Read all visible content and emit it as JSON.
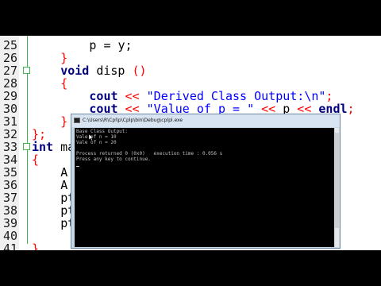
{
  "editor": {
    "lines": [
      {
        "n": "25",
        "indent": 8,
        "parts": [
          [
            "p = y;",
            "plain"
          ]
        ]
      },
      {
        "n": "26",
        "indent": 4,
        "parts": [
          [
            "}",
            "brc"
          ]
        ]
      },
      {
        "n": "27",
        "indent": 4,
        "parts": [
          [
            "void",
            "kw"
          ],
          [
            " disp ",
            "plain"
          ],
          [
            "()",
            "brc"
          ]
        ],
        "fold": true
      },
      {
        "n": "28",
        "indent": 4,
        "parts": [
          [
            "{",
            "brc"
          ]
        ]
      },
      {
        "n": "29",
        "indent": 8,
        "parts": [
          [
            "cout",
            "kw"
          ],
          [
            " ",
            "plain"
          ],
          [
            "<<",
            "op"
          ],
          [
            " ",
            "plain"
          ],
          [
            "\"Derived Class Output:\\n\"",
            "str"
          ],
          [
            ";",
            "op"
          ]
        ]
      },
      {
        "n": "30",
        "indent": 8,
        "parts": [
          [
            "cout",
            "kw"
          ],
          [
            " ",
            "plain"
          ],
          [
            "<<",
            "op"
          ],
          [
            " ",
            "plain"
          ],
          [
            "\"Value of p = \"",
            "str"
          ],
          [
            " ",
            "plain"
          ],
          [
            "<<",
            "op"
          ],
          [
            " p ",
            "plain"
          ],
          [
            "<<",
            "op"
          ],
          [
            " ",
            "plain"
          ],
          [
            "endl",
            "kw"
          ],
          [
            ";",
            "op"
          ]
        ]
      },
      {
        "n": "31",
        "indent": 4,
        "parts": [
          [
            "}",
            "brc"
          ]
        ]
      },
      {
        "n": "32",
        "indent": 0,
        "parts": [
          [
            "};",
            "brc"
          ]
        ]
      },
      {
        "n": "33",
        "indent": 0,
        "parts": [
          [
            "int",
            "kw"
          ],
          [
            " ma",
            "plain"
          ]
        ],
        "fold": true
      },
      {
        "n": "34",
        "indent": 0,
        "parts": [
          [
            "{",
            "brc"
          ]
        ]
      },
      {
        "n": "35",
        "indent": 4,
        "parts": [
          [
            "A",
            "plain"
          ]
        ]
      },
      {
        "n": "36",
        "indent": 4,
        "parts": [
          [
            "A",
            "plain"
          ]
        ]
      },
      {
        "n": "37",
        "indent": 4,
        "parts": [
          [
            "ptr",
            "plain"
          ]
        ]
      },
      {
        "n": "38",
        "indent": 4,
        "parts": [
          [
            "ptr",
            "plain"
          ]
        ]
      },
      {
        "n": "39",
        "indent": 4,
        "parts": [
          [
            "ptr",
            "plain"
          ]
        ]
      },
      {
        "n": "40",
        "indent": 0,
        "parts": []
      },
      {
        "n": "41",
        "indent": 0,
        "parts": [
          [
            "}",
            "brc"
          ]
        ]
      }
    ]
  },
  "console": {
    "title": "C:\\Users\\R\\Cpl\\p\\Cplp\\bin\\Debug\\cplpl.exe",
    "lines": [
      "Base Class Output:",
      "Vale of n = 10",
      "Vale of n = 20",
      "",
      "Process returned 0 (0x0)   execution time : 0.056 s",
      "Press any key to continue."
    ]
  },
  "colors": {
    "keyword": "#00007f",
    "string": "#0000ff",
    "operator": "#ff0000",
    "fold_line": "#3cb84a"
  }
}
